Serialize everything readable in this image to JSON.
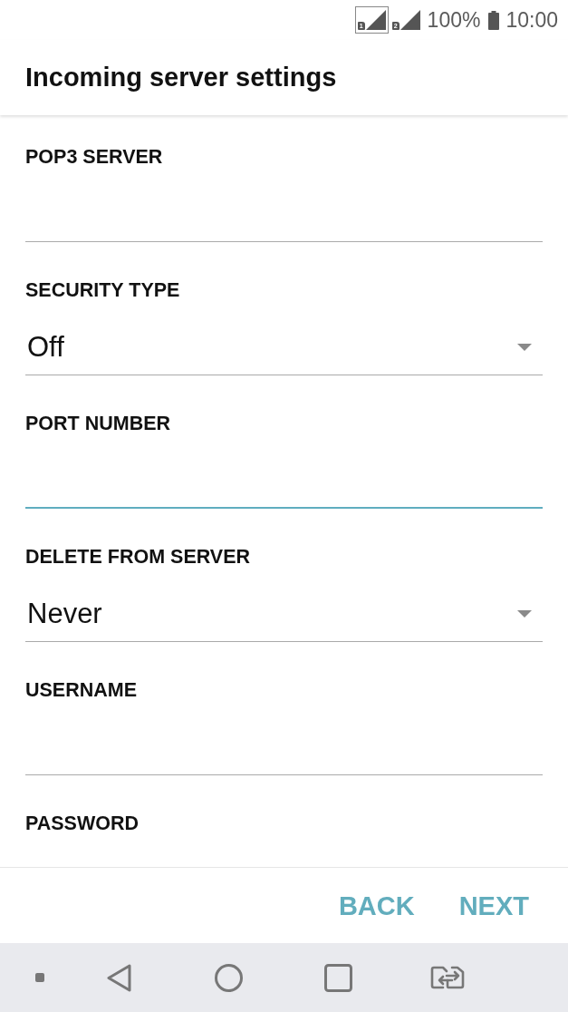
{
  "status_bar": {
    "sims": [
      {
        "label": "1",
        "selected": true
      },
      {
        "label": "2",
        "selected": false
      }
    ],
    "battery": "100%",
    "time": "10:00"
  },
  "title": "Incoming server settings",
  "fields": [
    {
      "label": "POP3 SERVER",
      "kind": "text",
      "focused": false
    },
    {
      "label": "SECURITY TYPE",
      "kind": "dropdown",
      "value": "Off",
      "focused": false
    },
    {
      "label": "PORT NUMBER",
      "kind": "text",
      "focused": true
    },
    {
      "label": "DELETE FROM SERVER",
      "kind": "dropdown",
      "value": "Never",
      "focused": false
    },
    {
      "label": "USERNAME",
      "kind": "text",
      "focused": false
    },
    {
      "label": "PASSWORD",
      "kind": "label"
    }
  ],
  "buttons": [
    {
      "label": "BACK"
    },
    {
      "label": "NEXT"
    }
  ]
}
